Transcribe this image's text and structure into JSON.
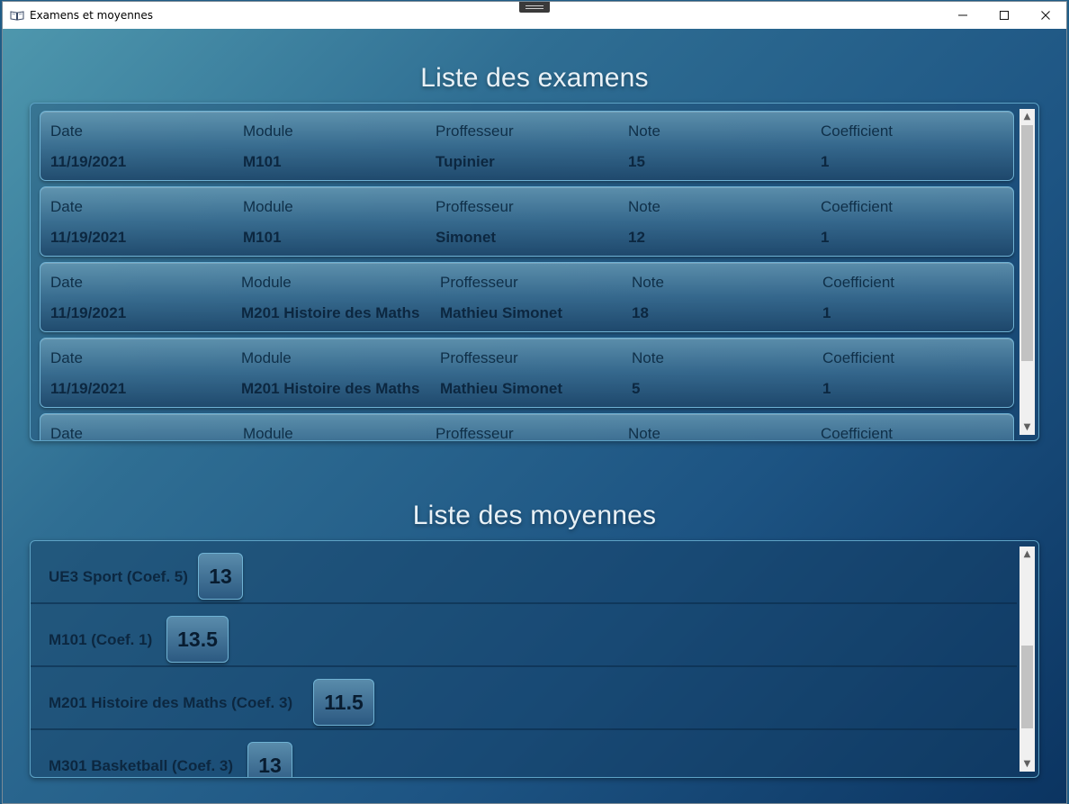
{
  "window": {
    "title": "Examens et moyennes",
    "icon": "open-book-icon"
  },
  "controls": {
    "minimize_icon": "minimize-icon",
    "maximize_icon": "maximize-icon",
    "close_icon": "close-icon"
  },
  "exams": {
    "title": "Liste des examens",
    "headers": {
      "date": "Date",
      "module": "Module",
      "professor": "Proffesseur",
      "grade": "Note",
      "coefficient": "Coefficient"
    },
    "rows": [
      {
        "date": "11/19/2021",
        "module": "M101",
        "professor": "Tupinier",
        "grade": "15",
        "coefficient": "1"
      },
      {
        "date": "11/19/2021",
        "module": "M101",
        "professor": "Simonet",
        "grade": "12",
        "coefficient": "1"
      },
      {
        "date": "11/19/2021",
        "module": "M201 Histoire des Maths",
        "professor": "Mathieu Simonet",
        "grade": "18",
        "coefficient": "1"
      },
      {
        "date": "11/19/2021",
        "module": "M201 Histoire des Maths",
        "professor": "Mathieu Simonet",
        "grade": "5",
        "coefficient": "1"
      }
    ],
    "partial_row_headers": {
      "date": "Date",
      "module": "Module",
      "professor": "Proffesseur",
      "grade": "Note",
      "coefficient": "Coefficient"
    }
  },
  "averages": {
    "title": "Liste des moyennes",
    "rows": [
      {
        "label": "UE3 Sport (Coef. 5)",
        "value": "13"
      },
      {
        "label": "M101 (Coef. 1)",
        "value": "13.5"
      },
      {
        "label": "M201 Histoire des Maths (Coef. 3)",
        "value": "11.5"
      },
      {
        "label": "M301 Basketball (Coef. 3)",
        "value": "13"
      }
    ]
  },
  "colors": {
    "background_start": "#4e97ad",
    "background_end": "#0b3461",
    "card_border": "#6fb2d4",
    "text_dark": "#0c2740",
    "title_text": "#e9f1f6"
  }
}
